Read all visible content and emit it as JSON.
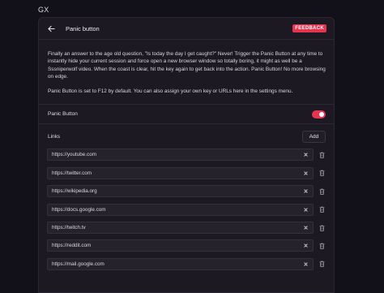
{
  "app": {
    "label": "GX"
  },
  "header": {
    "title": "Panic button",
    "feedback_label": "FEEDBACK"
  },
  "description": {
    "paragraph1": "Finally an answer to the age old question, \"Is today the day I get caught?\" Never! Trigger the Panic Button at any time to instantly hide your current session and force open a new browser window so totally boring, it might as well be a Sssniperwolf video. When the coast is clear, hit the key again to get back into the action. Panic Button! No more browsing on edge.",
    "paragraph2": "Panic Button is set to F12 by default. You can also assign your own key or URLs here in the settings menu."
  },
  "panic_toggle": {
    "label": "Panic Button",
    "enabled": true
  },
  "links": {
    "label": "Links",
    "add_label": "Add",
    "items": [
      "https://youtube.com",
      "https://twitter.com",
      "https://wikipedia.org",
      "https://docs.google.com",
      "https://twitch.tv",
      "https://reddit.com",
      "https://mail.google.com"
    ]
  },
  "colors": {
    "accent": "#e5344f",
    "background": "#121018",
    "panel": "#1c1923"
  }
}
